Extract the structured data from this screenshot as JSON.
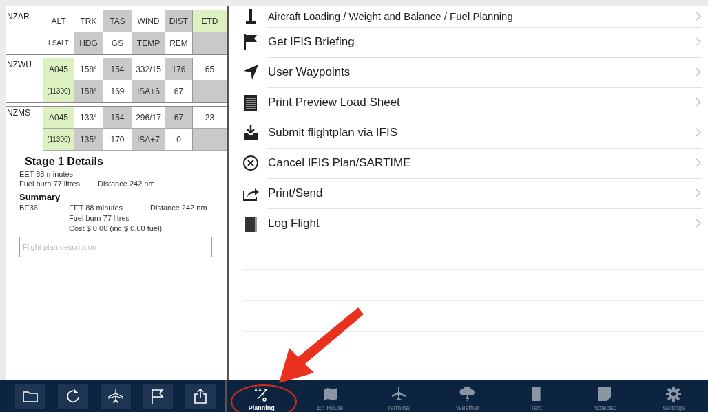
{
  "flight_table": {
    "groups": [
      {
        "code": "NZAR",
        "rows": [
          [
            {
              "text": "ALT",
              "color": "#ffffff"
            },
            {
              "text": "TRK",
              "color": "#ffffff"
            },
            {
              "text": "TAS",
              "color": "#c9c9c9"
            },
            {
              "text": "WIND",
              "color": "#ffffff"
            },
            {
              "text": "DIST",
              "color": "#c9c9c9"
            },
            {
              "text": "ETD",
              "color": "#ddf0c0"
            }
          ],
          [
            {
              "text": "LSALT",
              "color": "#ffffff"
            },
            {
              "text": "HDG",
              "color": "#c9c9c9"
            },
            {
              "text": "GS",
              "color": "#ffffff"
            },
            {
              "text": "TEMP",
              "color": "#c9c9c9"
            },
            {
              "text": "REM",
              "color": "#ffffff"
            },
            {
              "color": "#c9c9c9"
            }
          ]
        ]
      },
      {
        "code": "NZWU",
        "rows": [
          [
            {
              "text": "A045",
              "color": "#ddf0c0"
            },
            {
              "text": "158°",
              "color": "#ffffff"
            },
            {
              "text": "154",
              "color": "#c9c9c9"
            },
            {
              "text": "332/15",
              "color": "#ffffff"
            },
            {
              "text": "176",
              "color": "#c9c9c9"
            },
            {
              "text": "65",
              "color": "#ffffff"
            }
          ],
          [
            {
              "text": "(11300)",
              "color": "#ddf0c0"
            },
            {
              "text": "158°",
              "color": "#c9c9c9"
            },
            {
              "text": "169",
              "color": "#ffffff"
            },
            {
              "text": "ISA+6",
              "color": "#c9c9c9"
            },
            {
              "text": "67",
              "color": "#ffffff"
            },
            {
              "color": "#c9c9c9"
            }
          ]
        ]
      },
      {
        "code": "NZMS",
        "rows": [
          [
            {
              "text": "A045",
              "color": "#ddf0c0"
            },
            {
              "text": "133°",
              "color": "#ffffff"
            },
            {
              "text": "154",
              "color": "#c9c9c9"
            },
            {
              "text": "296/17",
              "color": "#ffffff"
            },
            {
              "text": "67",
              "color": "#c9c9c9"
            },
            {
              "text": "23",
              "color": "#ffffff"
            }
          ],
          [
            {
              "text": "(11300)",
              "color": "#ddf0c0"
            },
            {
              "text": "135°",
              "color": "#c9c9c9"
            },
            {
              "text": "170",
              "color": "#ffffff"
            },
            {
              "text": "ISA+7",
              "color": "#c9c9c9"
            },
            {
              "text": "0",
              "color": "#ffffff"
            },
            {
              "color": "#c9c9c9"
            }
          ]
        ]
      }
    ]
  },
  "stage_details": {
    "title": "Stage 1 Details",
    "eet": "EET 88 minutes",
    "fuel": "Fuel burn 77 litres",
    "distance": "Distance 242 nm"
  },
  "summary": {
    "title": "Summary",
    "aircraft": "BE36",
    "eet": "EET 88 minutes",
    "distance": "Distance 242 nm",
    "fuel": "Fuel burn 77 litres",
    "cost": "Cost $ 0.00 (inc $ 0.00 fuel)"
  },
  "description_field": {
    "placeholder": "Flight plan description"
  },
  "menu": [
    {
      "label": "Aircraft Loading / Weight and Balance / Fuel Planning"
    },
    {
      "label": "Get IFIS Briefing"
    },
    {
      "label": "User Waypoints"
    },
    {
      "label": "Print Preview Load Sheet"
    },
    {
      "label": "Submit flightplan via IFIS"
    },
    {
      "label": "Cancel IFIS Plan/SARTIME"
    },
    {
      "label": "Print/Send"
    },
    {
      "label": "Log Flight"
    }
  ],
  "tab_bar": [
    {
      "label": "Planning",
      "selected": true
    },
    {
      "label": "En Route",
      "selected": false
    },
    {
      "label": "Terminal",
      "selected": false
    },
    {
      "label": "Weather",
      "selected": false
    },
    {
      "label": "Text",
      "selected": false
    },
    {
      "label": "Notepad",
      "selected": false
    },
    {
      "label": "Settings",
      "selected": false
    }
  ]
}
